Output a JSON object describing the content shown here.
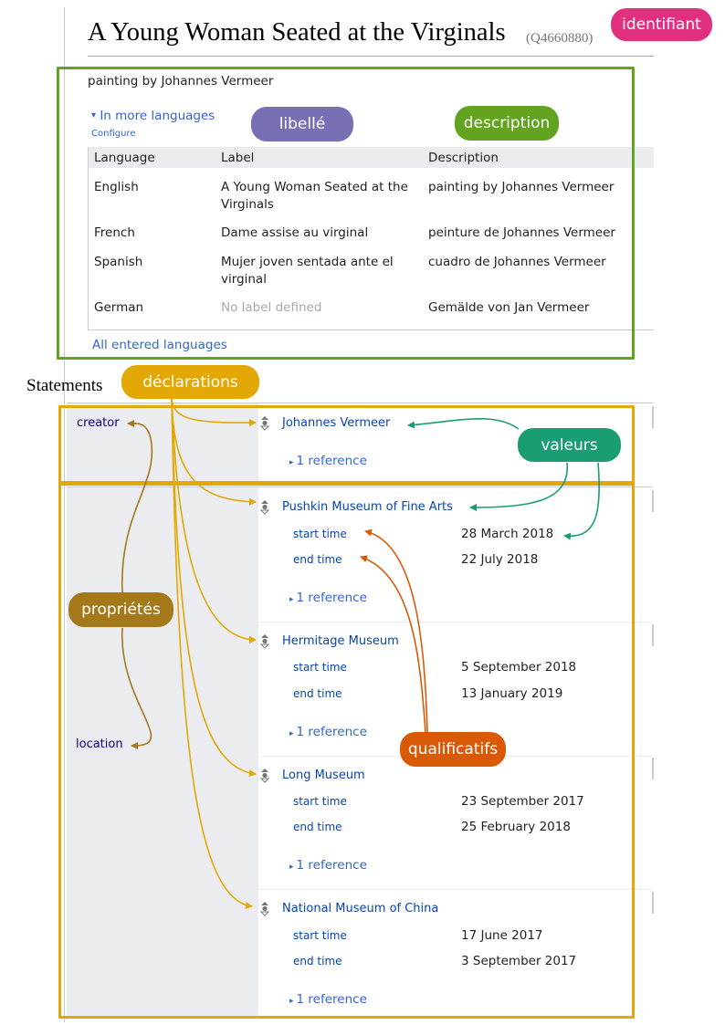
{
  "item": {
    "title": "A Young Woman Seated at the Virginals",
    "id": "(Q4660880)",
    "description": "painting by Johannes Vermeer"
  },
  "languages": {
    "toggle_arrow": "▾",
    "toggle_label": "In more languages",
    "configure_label": "Configure",
    "headers": [
      "Language",
      "Label",
      "Description"
    ],
    "rows": [
      {
        "language": "English",
        "label": "A Young Woman Seated at the Virginals",
        "description": "painting by Johannes Vermeer"
      },
      {
        "language": "French",
        "label": "Dame assise au virginal",
        "description": "peinture de Johannes Vermeer"
      },
      {
        "language": "Spanish",
        "label": "Mujer joven sentada ante el virginal",
        "description": "cuadro de Johannes Vermeer"
      },
      {
        "language": "German",
        "label": "No label defined",
        "description": "Gemälde von Jan Vermeer"
      }
    ],
    "all_link": "All entered languages"
  },
  "statements": {
    "heading": "Statements",
    "creator": {
      "property": "creator",
      "value": "Johannes Vermeer",
      "reference": "1 reference"
    },
    "location": {
      "property": "location",
      "values": [
        {
          "value": "Pushkin Museum of Fine Arts",
          "start_label": "start time",
          "start": "28 March 2018",
          "end_label": "end time",
          "end": "22 July 2018",
          "reference": "1 reference"
        },
        {
          "value": "Hermitage Museum",
          "start_label": "start time",
          "start": "5 September 2018",
          "end_label": "end time",
          "end": "13 January 2019",
          "reference": "1 reference"
        },
        {
          "value": "Long Museum",
          "start_label": "start time",
          "start": "23 September 2017",
          "end_label": "end time",
          "end": "25 February 2018",
          "reference": "1 reference"
        },
        {
          "value": "National Museum of China",
          "start_label": "start time",
          "start": "17 June 2017",
          "end_label": "end time",
          "end": "3 September 2017",
          "reference": "1 reference"
        }
      ]
    }
  },
  "annotations": {
    "identifiant": "identifiant",
    "libelle": "libellé",
    "description": "description",
    "declarations": "déclarations",
    "valeurs": "valeurs",
    "proprietes": "propriétés",
    "qualificatifs": "qualificatifs"
  },
  "colors": {
    "identifiant": "#e0307f",
    "libelle": "#7770b5",
    "description": "#62a320",
    "declarations": "#e3a805",
    "valeurs": "#1a9c75",
    "proprietes": "#a5791a",
    "qualificatifs": "#d85a07",
    "link": "#3366cc",
    "property": "#0b0080"
  }
}
